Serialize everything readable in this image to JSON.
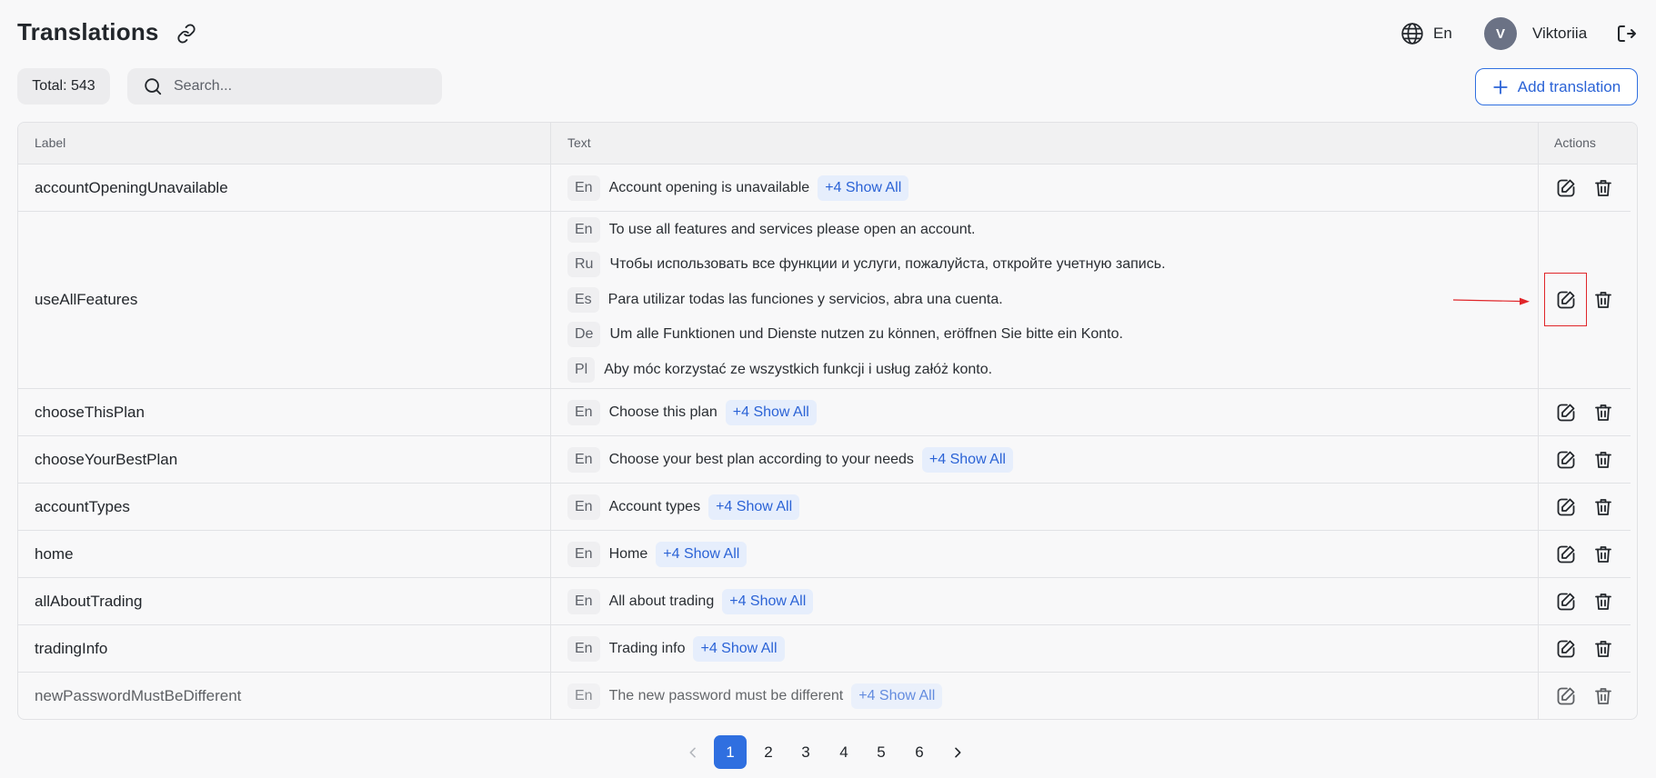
{
  "header": {
    "title": "Translations",
    "language": "En",
    "user_initial": "V",
    "user_name": "Viktoriia"
  },
  "toolbar": {
    "total_label": "Total: 543",
    "search_placeholder": "Search...",
    "add_label": "Add translation"
  },
  "table": {
    "columns": [
      "Label",
      "Text",
      "Actions"
    ],
    "rows": [
      {
        "label": "accountOpeningUnavailable",
        "texts": [
          {
            "lang": "En",
            "text": "Account opening is unavailable"
          }
        ],
        "show_all": "+4 Show All"
      },
      {
        "label": "useAllFeatures",
        "texts": [
          {
            "lang": "En",
            "text": "To use all features and services please open an account."
          },
          {
            "lang": "Ru",
            "text": "Чтобы использовать все функции и услуги, пожалуйста, откройте учетную запись."
          },
          {
            "lang": "Es",
            "text": "Para utilizar todas las funciones y servicios, abra una cuenta."
          },
          {
            "lang": "De",
            "text": "Um alle Funktionen und Dienste nutzen zu können, eröffnen Sie bitte ein Konto."
          },
          {
            "lang": "Pl",
            "text": "Aby móc korzystać ze wszystkich funkcji i usług załóż konto."
          }
        ]
      },
      {
        "label": "chooseThisPlan",
        "texts": [
          {
            "lang": "En",
            "text": "Choose this plan"
          }
        ],
        "show_all": "+4 Show All"
      },
      {
        "label": "chooseYourBestPlan",
        "texts": [
          {
            "lang": "En",
            "text": "Choose your best plan according to your needs"
          }
        ],
        "show_all": "+4 Show All"
      },
      {
        "label": "accountTypes",
        "texts": [
          {
            "lang": "En",
            "text": "Account types"
          }
        ],
        "show_all": "+4 Show All"
      },
      {
        "label": "home",
        "texts": [
          {
            "lang": "En",
            "text": "Home"
          }
        ],
        "show_all": "+4 Show All"
      },
      {
        "label": "allAboutTrading",
        "texts": [
          {
            "lang": "En",
            "text": "All about trading"
          }
        ],
        "show_all": "+4 Show All"
      },
      {
        "label": "tradingInfo",
        "texts": [
          {
            "lang": "En",
            "text": "Trading info"
          }
        ],
        "show_all": "+4 Show All"
      },
      {
        "label": "newPasswordMustBeDifferent",
        "texts": [
          {
            "lang": "En",
            "text": "The new password must be different"
          }
        ],
        "show_all": "+4 Show All"
      }
    ]
  },
  "pagination": {
    "pages": [
      "1",
      "2",
      "3",
      "4",
      "5",
      "6"
    ],
    "current": "1"
  },
  "icons": {
    "copy_link": "link-icon",
    "language": "globe-icon",
    "logout": "logout-icon",
    "search": "search-icon",
    "add": "plus-icon",
    "edit": "edit-icon",
    "delete": "trash-icon",
    "prev": "chevron-left-icon",
    "next": "chevron-right-icon"
  },
  "colors": {
    "accent": "#2f6fe0",
    "annotation": "#e0262a"
  }
}
